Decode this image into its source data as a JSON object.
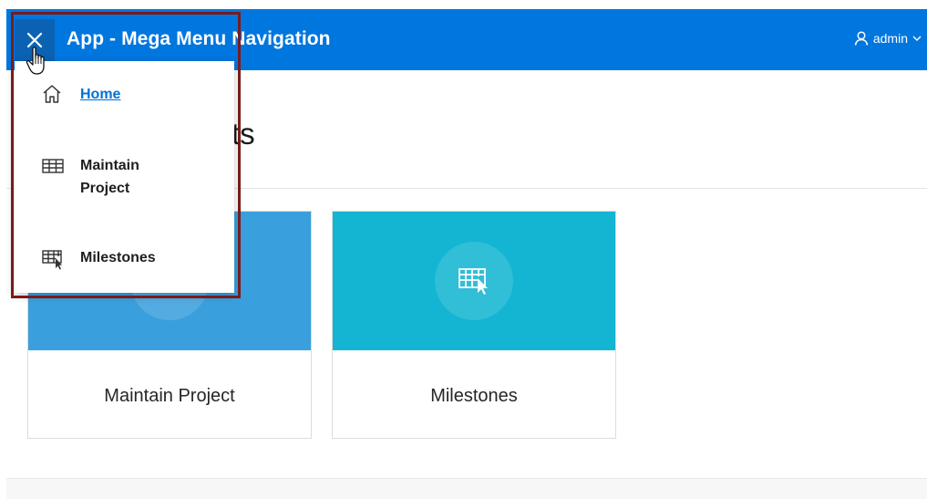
{
  "header": {
    "close_glyph": "✕",
    "app_title": "App - Mega Menu Navigation",
    "user_label": "admin"
  },
  "page": {
    "title_visible_fragment": "ts"
  },
  "cards": [
    {
      "label": "Maintain Project",
      "color": "#3aa0dd",
      "icon": "table-icon"
    },
    {
      "label": "Milestones",
      "color": "#13b5d2",
      "icon": "table-cursor-icon"
    }
  ],
  "mega_menu": {
    "items": [
      {
        "label": "Home",
        "icon": "home-icon",
        "active": true
      },
      {
        "label": "Maintain Project",
        "icon": "table-icon",
        "active": false
      },
      {
        "label": "Milestones",
        "icon": "table-cursor-icon",
        "active": false
      }
    ]
  },
  "colors": {
    "header_bg": "#0076df",
    "toggle_bg": "#0b62b3",
    "link": "#0072d6",
    "highlight_border": "#7a1b1b"
  }
}
